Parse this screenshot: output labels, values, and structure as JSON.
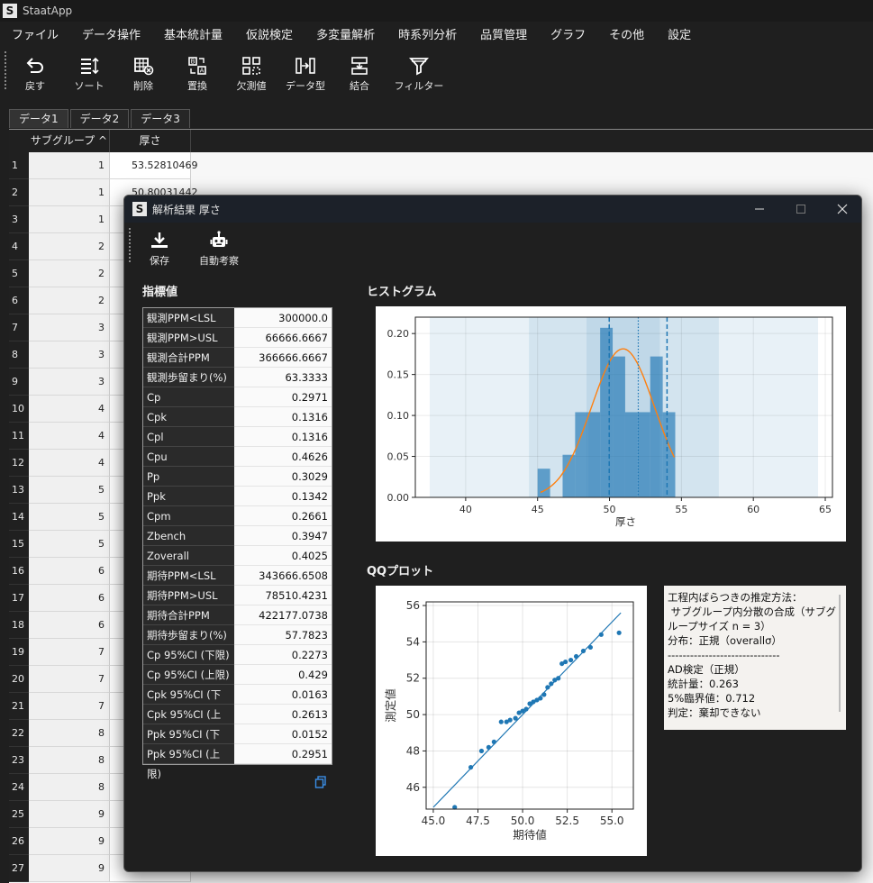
{
  "app": {
    "logo": "S",
    "title": "StaatApp"
  },
  "menu": [
    "ファイル",
    "データ操作",
    "基本統計量",
    "仮説検定",
    "多変量解析",
    "時系列分析",
    "品質管理",
    "グラフ",
    "その他",
    "設定"
  ],
  "toolbar": [
    {
      "label": "戻す",
      "icon": "undo-icon"
    },
    {
      "label": "ソート",
      "icon": "sort-icon"
    },
    {
      "label": "削除",
      "icon": "delete-table-icon"
    },
    {
      "label": "置換",
      "icon": "replace-icon"
    },
    {
      "label": "欠測値",
      "icon": "missing-value-icon"
    },
    {
      "label": "データ型",
      "icon": "data-type-icon"
    },
    {
      "label": "結合",
      "icon": "merge-icon"
    },
    {
      "label": "フィルター",
      "icon": "filter-icon"
    }
  ],
  "tabs": [
    "データ1",
    "データ2",
    "データ3"
  ],
  "grid": {
    "headers": [
      "サブグループ ^",
      "厚さ"
    ],
    "rows": [
      {
        "n": "1",
        "sub": "1",
        "thk": "53.52810469"
      },
      {
        "n": "2",
        "sub": "1",
        "thk": "50.80031442"
      },
      {
        "n": "3",
        "sub": "1",
        "thk": ""
      },
      {
        "n": "4",
        "sub": "2",
        "thk": ""
      },
      {
        "n": "5",
        "sub": "2",
        "thk": ""
      },
      {
        "n": "6",
        "sub": "2",
        "thk": ""
      },
      {
        "n": "7",
        "sub": "3",
        "thk": ""
      },
      {
        "n": "8",
        "sub": "3",
        "thk": ""
      },
      {
        "n": "9",
        "sub": "3",
        "thk": ""
      },
      {
        "n": "10",
        "sub": "4",
        "thk": ""
      },
      {
        "n": "11",
        "sub": "4",
        "thk": ""
      },
      {
        "n": "12",
        "sub": "4",
        "thk": ""
      },
      {
        "n": "13",
        "sub": "5",
        "thk": ""
      },
      {
        "n": "14",
        "sub": "5",
        "thk": ""
      },
      {
        "n": "15",
        "sub": "5",
        "thk": ""
      },
      {
        "n": "16",
        "sub": "6",
        "thk": ""
      },
      {
        "n": "17",
        "sub": "6",
        "thk": ""
      },
      {
        "n": "18",
        "sub": "6",
        "thk": ""
      },
      {
        "n": "19",
        "sub": "7",
        "thk": ""
      },
      {
        "n": "20",
        "sub": "7",
        "thk": ""
      },
      {
        "n": "21",
        "sub": "7",
        "thk": ""
      },
      {
        "n": "22",
        "sub": "8",
        "thk": ""
      },
      {
        "n": "23",
        "sub": "8",
        "thk": ""
      },
      {
        "n": "24",
        "sub": "8",
        "thk": ""
      },
      {
        "n": "25",
        "sub": "9",
        "thk": ""
      },
      {
        "n": "26",
        "sub": "9",
        "thk": ""
      },
      {
        "n": "27",
        "sub": "9",
        "thk": ""
      }
    ]
  },
  "dialog": {
    "logo": "S",
    "title": "解析結果 厚さ",
    "tools": [
      {
        "label": "保存",
        "icon": "download-icon"
      },
      {
        "label": "自動考察",
        "icon": "robot-icon"
      }
    ],
    "stats_title": "指標値",
    "hist_title": "ヒストグラム",
    "qq_title": "QQプロット",
    "stats": [
      [
        "観測PPM<LSL",
        "300000.0"
      ],
      [
        "観測PPM>USL",
        "66666.6667"
      ],
      [
        "観測合計PPM",
        "366666.6667"
      ],
      [
        "観測歩留まり(%)",
        "63.3333"
      ],
      [
        "Cp",
        "0.2971"
      ],
      [
        "Cpk",
        "0.1316"
      ],
      [
        "Cpl",
        "0.1316"
      ],
      [
        "Cpu",
        "0.4626"
      ],
      [
        "Pp",
        "0.3029"
      ],
      [
        "Ppk",
        "0.1342"
      ],
      [
        "Cpm",
        "0.2661"
      ],
      [
        "Zbench",
        "0.3947"
      ],
      [
        "Zoverall",
        "0.4025"
      ],
      [
        "期待PPM<LSL",
        "343666.6508"
      ],
      [
        "期待PPM>USL",
        "78510.4231"
      ],
      [
        "期待合計PPM",
        "422177.0738"
      ],
      [
        "期待歩留まり(%)",
        "57.7823"
      ],
      [
        "Cp 95%CI (下限)",
        "0.2273"
      ],
      [
        "Cp 95%CI (上限)",
        "0.429"
      ],
      [
        "Cpk 95%CI (下限)",
        "0.0163"
      ],
      [
        "Cpk 95%CI (上限)",
        "0.2613"
      ],
      [
        "Ppk 95%CI (下限)",
        "0.0152"
      ],
      [
        "Ppk 95%CI (上限)",
        "0.2951"
      ]
    ],
    "info": [
      "工程内ばらつきの推定方法：",
      " サブグループ内分散の合成（サブグループサイズ n = 3）",
      "分布：正規（overallσ）",
      "",
      "------------------------------",
      "AD検定（正規）",
      "統計量：0.263",
      "5%臨界値：0.712",
      "判定：棄却できない"
    ]
  },
  "colors": {
    "bar": "#1f77b4",
    "curve": "#ff7f0e",
    "band": "#1f77b4"
  },
  "chart_data": [
    {
      "type": "bar",
      "xlabel": "厚さ",
      "ylabel": "",
      "xlim": [
        36.5,
        65.5
      ],
      "ylim": [
        0,
        0.22
      ],
      "xticks": [
        40,
        45,
        50,
        55,
        60,
        65
      ],
      "yticks": [
        "0.00",
        "0.05",
        "0.10",
        "0.15",
        "0.20"
      ],
      "bin_edges": [
        45.0,
        45.87,
        46.74,
        47.61,
        48.48,
        49.35,
        50.22,
        51.09,
        51.96,
        52.83,
        53.7,
        54.57
      ],
      "values": [
        0.035,
        0.0,
        0.052,
        0.104,
        0.104,
        0.207,
        0.172,
        0.104,
        0.104,
        0.172,
        0.104
      ],
      "normal_curve": {
        "mean": 50.94,
        "sd": 2.2
      },
      "lines": {
        "lsl": 49.98,
        "target": 52.0,
        "usl": 54.0
      },
      "bands": [
        [
          37.5,
          64.5
        ],
        [
          44.4,
          57.6
        ],
        [
          48.4,
          53.5
        ]
      ]
    },
    {
      "type": "scatter",
      "xlabel": "期待値",
      "ylabel": "測定値",
      "xlim": [
        44.6,
        56.2
      ],
      "ylim": [
        44.8,
        56.2
      ],
      "xticks": [
        "45.0",
        "47.5",
        "50.0",
        "52.5",
        "55.0"
      ],
      "yticks": [
        46,
        48,
        50,
        52,
        54,
        56
      ],
      "x": [
        46.2,
        47.1,
        47.7,
        48.1,
        48.4,
        48.8,
        49.1,
        49.3,
        49.6,
        49.8,
        50.0,
        50.2,
        50.4,
        50.6,
        50.8,
        51.0,
        51.2,
        51.4,
        51.6,
        51.8,
        52.0,
        52.2,
        52.4,
        52.7,
        53.0,
        53.4,
        53.8,
        54.4,
        55.4
      ],
      "y": [
        44.9,
        47.1,
        48.0,
        48.2,
        48.5,
        49.6,
        49.6,
        49.7,
        49.8,
        50.1,
        50.2,
        50.3,
        50.6,
        50.7,
        50.8,
        50.9,
        51.1,
        51.5,
        51.7,
        51.9,
        52.0,
        52.8,
        52.9,
        53.0,
        53.2,
        53.5,
        53.7,
        54.4,
        54.5
      ],
      "fit_line": {
        "x": [
          45.0,
          55.5
        ],
        "y": [
          44.9,
          55.6
        ]
      }
    }
  ]
}
